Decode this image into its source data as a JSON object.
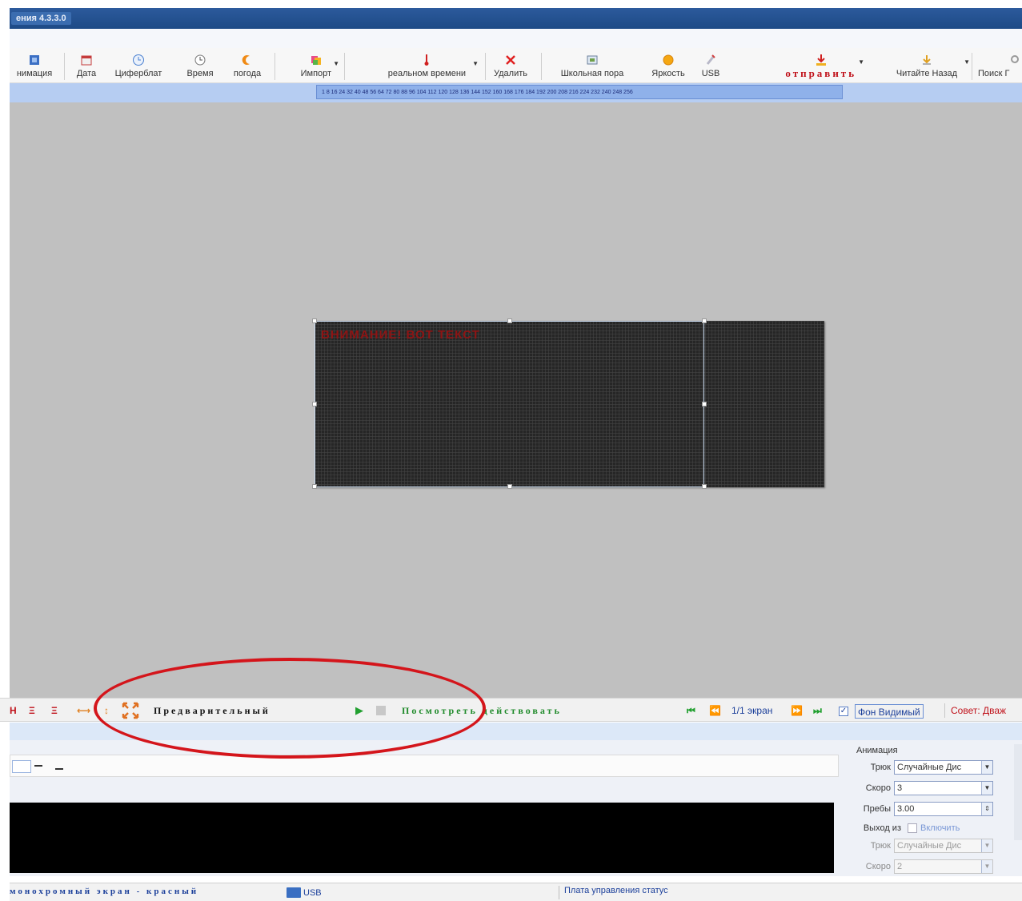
{
  "window": {
    "title": "ения 4.3.3.0"
  },
  "toolbar": {
    "items": [
      {
        "label": "нимация",
        "icon": "animation-icon"
      },
      {
        "label": "Дата",
        "icon": "date-icon"
      },
      {
        "label": "Циферблат",
        "icon": "clock-dial-icon"
      },
      {
        "label": "Время",
        "icon": "time-icon"
      },
      {
        "label": "погода",
        "icon": "weather-icon"
      },
      {
        "label": "Импорт",
        "icon": "import-icon"
      },
      {
        "label": "реальном времени",
        "icon": "thermometer-icon"
      },
      {
        "label": "Удалить",
        "icon": "delete-icon"
      },
      {
        "label": "Школьная пора",
        "icon": "school-time-icon"
      },
      {
        "label": "Яркость",
        "icon": "brightness-icon"
      },
      {
        "label": "USB",
        "icon": "usb-icon"
      },
      {
        "label": "отправить",
        "icon": "send-icon"
      },
      {
        "label": "Читайте Назад",
        "icon": "read-back-icon"
      },
      {
        "label": "Поиск Г",
        "icon": "search-icon"
      }
    ]
  },
  "ruler": {
    "ticks": "1  8  16 24 32 40 48 56 64 72 80 88 96 104 112 120 128 136 144 152 160 168 176 184 192 200 208 216 224 232 240 248 256"
  },
  "led_screen": {
    "text": "ВНИМАНИЕ! ВОТ ТЕКСТ"
  },
  "control_bar": {
    "preview_label": "Предварительный",
    "view_label": "Посмотреть действовать",
    "screens_counter": "1/1 экран",
    "bg_visible_label": "Фон Видимый",
    "bg_visible_checked": true,
    "tip_label": "Совет: Дваж"
  },
  "animation_panel": {
    "title": "Анимация",
    "fields": [
      {
        "label": "Трюк",
        "value": "Случайные Дис"
      },
      {
        "label": "Скоро",
        "value": "3"
      },
      {
        "label": "Пребы",
        "value": "3.00"
      }
    ],
    "exit_label": "Выход из",
    "enable_label": "Включить",
    "exit_fields": [
      {
        "label": "Трюк",
        "value": "Случайные Дис"
      },
      {
        "label": "Скоро",
        "value": "2"
      }
    ]
  },
  "status_bar": {
    "screen_type": "монохромный экран - красный",
    "connection": "USB",
    "control_status": "Плата управления статус"
  },
  "colors": {
    "accent_red": "#c0121b",
    "accent_green": "#1f8a2a",
    "accent_blue": "#1b3f9a",
    "workspace": "#c0c0c0"
  }
}
